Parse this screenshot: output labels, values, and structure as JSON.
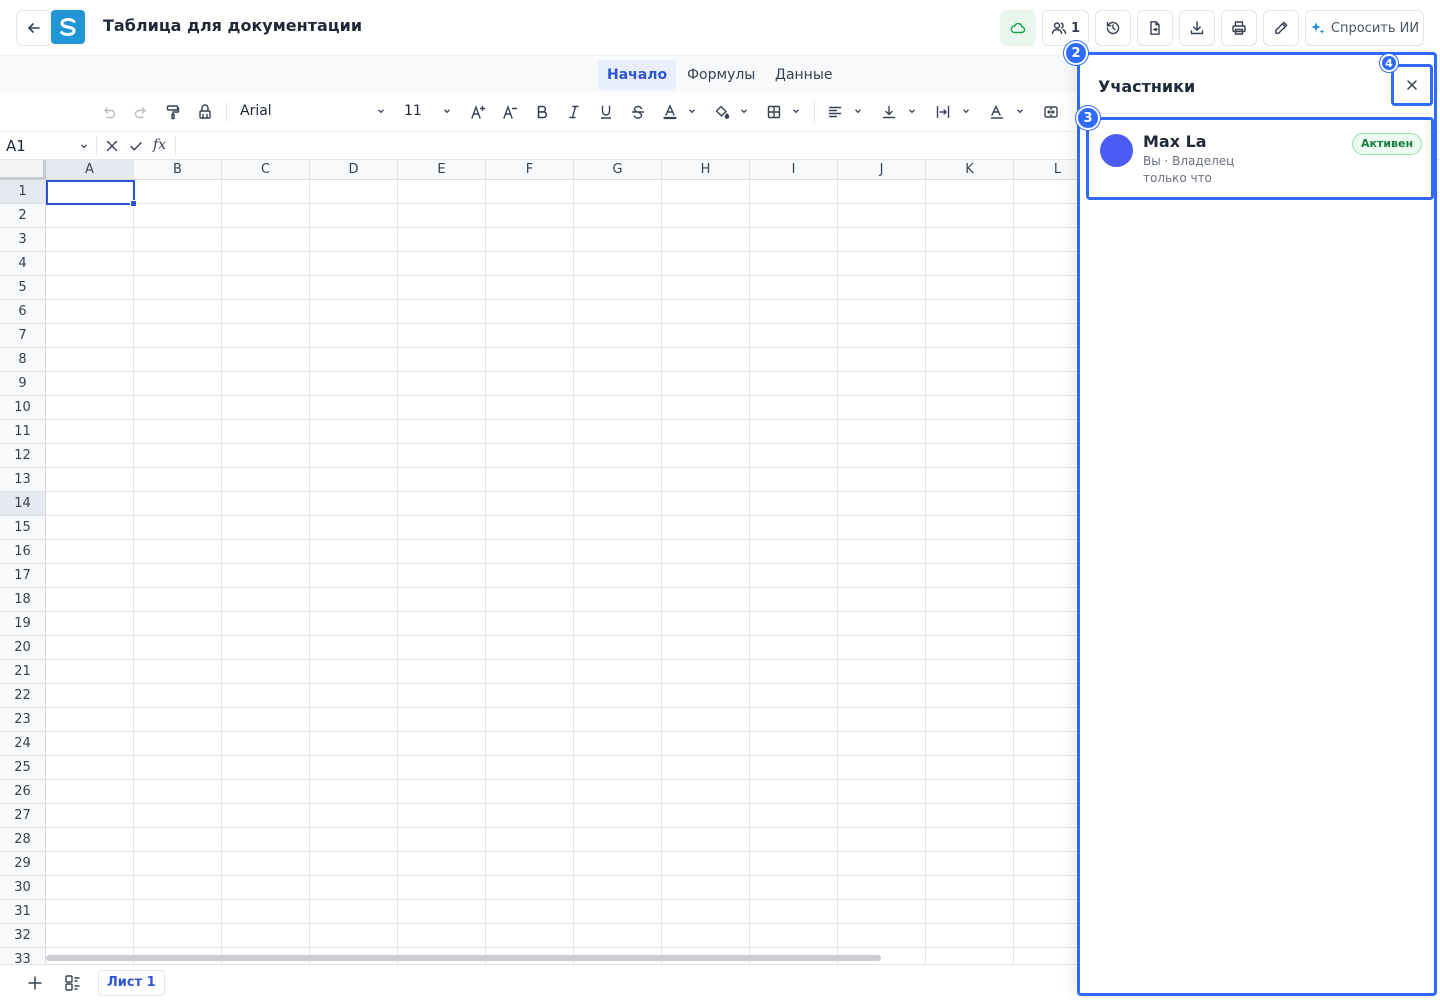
{
  "header": {
    "title": "Таблица для документации",
    "participants_count": "1",
    "ai_label": "Спросить ИИ"
  },
  "tabs": [
    {
      "label": "Начало",
      "active": true
    },
    {
      "label": "Формулы",
      "active": false
    },
    {
      "label": "Данные",
      "active": false
    }
  ],
  "toolbar": {
    "font_name": "Arial",
    "font_size": "11"
  },
  "formula_bar": {
    "cell_ref": "A1",
    "fx_label": "fx",
    "value": ""
  },
  "grid": {
    "columns": [
      "A",
      "B",
      "C",
      "D",
      "E",
      "F",
      "G",
      "H",
      "I",
      "J",
      "K",
      "L"
    ],
    "rows": [
      "1",
      "2",
      "3",
      "4",
      "5",
      "6",
      "7",
      "8",
      "9",
      "10",
      "11",
      "12",
      "13",
      "14",
      "15",
      "16",
      "17",
      "18",
      "19",
      "20",
      "21",
      "22",
      "23",
      "24",
      "25",
      "26",
      "27",
      "28",
      "29",
      "30",
      "31",
      "32",
      "33"
    ],
    "selected_column": "A",
    "selected_rows": [
      "1",
      "14"
    ]
  },
  "sheets": [
    {
      "label": "Лист 1",
      "active": true
    }
  ],
  "panel": {
    "title": "Участники",
    "members": [
      {
        "name": "Max La",
        "role": "Вы · Владелец",
        "last_seen": "только что",
        "status": "Активен"
      }
    ]
  },
  "markers": [
    "2",
    "3",
    "4"
  ],
  "colors": {
    "accent": "#2f55d4",
    "highlight": "#2f6bff",
    "logo": "#2196d6",
    "avatar": "#4a5cf5",
    "status_active": "#15803d"
  }
}
